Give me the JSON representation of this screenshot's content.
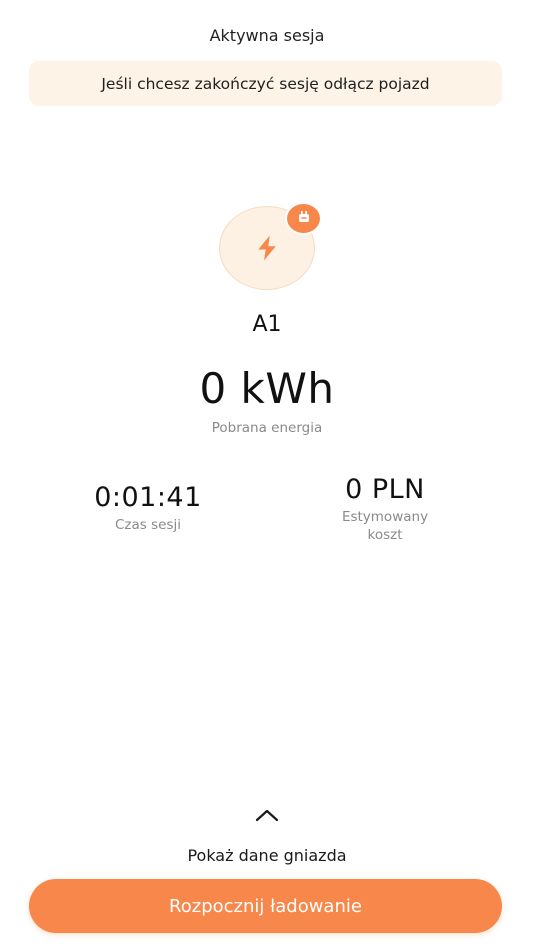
{
  "header": {
    "title": "Aktywna sesja"
  },
  "banner": {
    "text": "Jeśli chcesz zakończyć sesję odłącz pojazd"
  },
  "connector": {
    "icon": "lightning-icon",
    "badge_icon": "plug-icon",
    "label": "A1"
  },
  "energy": {
    "value": "0 kWh",
    "caption": "Pobrana energia"
  },
  "stats": {
    "session_time": {
      "value": "0:01:41",
      "caption": "Czas sesji"
    },
    "estimated_cost": {
      "value": "0 PLN",
      "caption_line1": "Estymowany",
      "caption_line2": "koszt"
    }
  },
  "expand": {
    "icon": "chevron-up-icon",
    "label": "Pokaż dane gniazda"
  },
  "actions": {
    "primary_label": "Rozpocznij ładowanie"
  },
  "colors": {
    "accent": "#f7874a",
    "banner_bg": "#fdf3e6",
    "circle_bg": "#fdf1e4",
    "muted_text": "#8a8a8a"
  }
}
